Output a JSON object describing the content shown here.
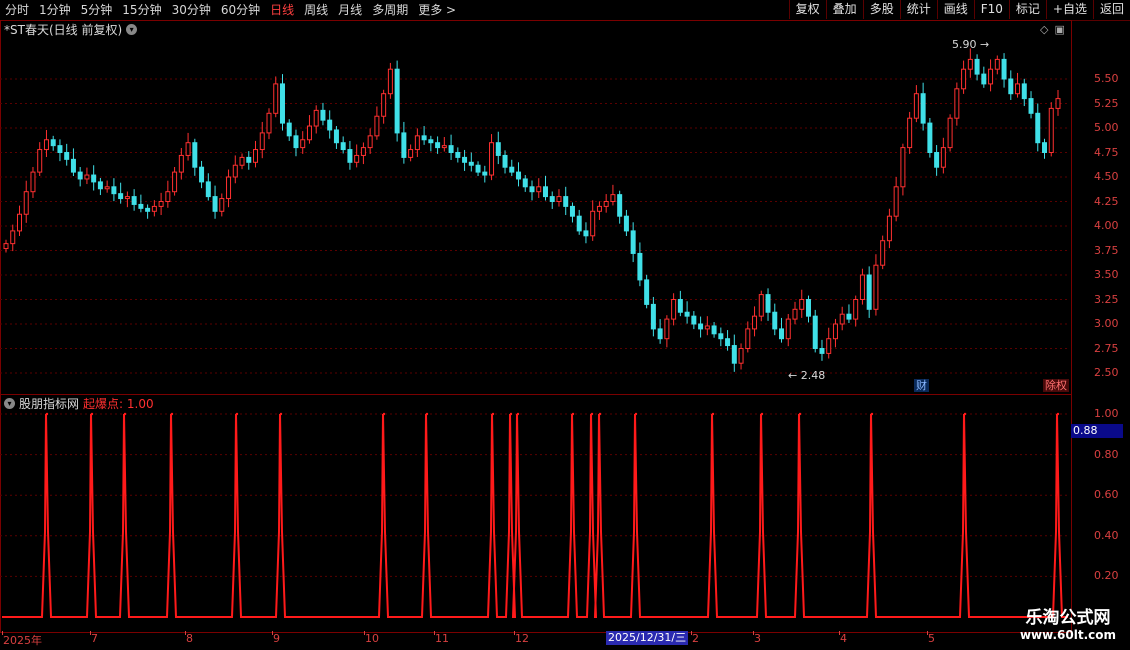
{
  "toolbar": {
    "periods": [
      "分时",
      "1分钟",
      "5分钟",
      "15分钟",
      "30分钟",
      "60分钟",
      "日线",
      "周线",
      "月线",
      "多周期",
      "更多 >"
    ],
    "active_period": "日线",
    "buttons": [
      "复权",
      "叠加",
      "多股",
      "统计",
      "画线",
      "F10",
      "标记",
      "+自选",
      "返回"
    ]
  },
  "main_chart": {
    "title": "*ST春天(日线 前复权)",
    "high_annotation": "5.90",
    "low_annotation": "2.48",
    "tags": {
      "financial": "财",
      "lift": "除权"
    }
  },
  "sub_chart": {
    "name": "股朋指标网",
    "indicator": "起爆点: 1.00",
    "current_value": "0.88"
  },
  "x_axis": {
    "labels": [
      "2025年",
      "7",
      "8",
      "9",
      "10",
      "11",
      "12",
      "2",
      "3",
      "4",
      "5"
    ],
    "cursor_date": "2025/12/31/三"
  },
  "watermark": {
    "line1": "乐淘公式网",
    "line2": "www.60lt.com"
  },
  "chart_data": [
    {
      "type": "candlestick",
      "title": "*ST春天(日线 前复权)",
      "y_ticks": [
        "5.50",
        "5.25",
        "5.00",
        "4.75",
        "4.50",
        "4.25",
        "4.00",
        "3.75",
        "3.50",
        "3.25",
        "3.00",
        "2.75",
        "2.50"
      ],
      "ylim": [
        2.35,
        6.05
      ],
      "colors": {
        "up": "#ff3030",
        "down": "#40e0e8"
      },
      "x_labels": [
        "2025年",
        "7",
        "8",
        "9",
        "10",
        "11",
        "12",
        "2",
        "3",
        "4",
        "5"
      ],
      "close": [
        3.82,
        3.95,
        4.12,
        4.35,
        4.55,
        4.78,
        4.88,
        4.82,
        4.75,
        4.68,
        4.55,
        4.48,
        4.52,
        4.45,
        4.38,
        4.4,
        4.33,
        4.28,
        4.3,
        4.22,
        4.18,
        4.15,
        4.2,
        4.25,
        4.35,
        4.55,
        4.72,
        4.85,
        4.6,
        4.45,
        4.3,
        4.15,
        4.28,
        4.5,
        4.62,
        4.7,
        4.65,
        4.78,
        4.95,
        5.15,
        5.45,
        5.05,
        4.92,
        4.8,
        4.88,
        5.02,
        5.18,
        5.08,
        4.98,
        4.85,
        4.78,
        4.65,
        4.72,
        4.8,
        4.92,
        5.12,
        5.35,
        5.6,
        4.95,
        4.7,
        4.78,
        4.92,
        4.88,
        4.85,
        4.8,
        4.82,
        4.75,
        4.7,
        4.65,
        4.62,
        4.55,
        4.52,
        4.85,
        4.72,
        4.6,
        4.55,
        4.48,
        4.4,
        4.35,
        4.4,
        4.3,
        4.25,
        4.3,
        4.2,
        4.1,
        3.95,
        3.9,
        4.15,
        4.2,
        4.25,
        4.32,
        4.1,
        3.95,
        3.72,
        3.45,
        3.2,
        2.95,
        2.85,
        3.05,
        3.25,
        3.12,
        3.08,
        3.0,
        2.95,
        2.98,
        2.9,
        2.85,
        2.78,
        2.6,
        2.75,
        2.95,
        3.08,
        3.3,
        3.12,
        2.95,
        2.85,
        3.05,
        3.15,
        3.25,
        3.08,
        2.75,
        2.7,
        2.85,
        3.0,
        3.1,
        3.05,
        3.25,
        3.5,
        3.15,
        3.6,
        3.85,
        4.1,
        4.4,
        4.8,
        5.1,
        5.35,
        5.05,
        4.75,
        4.6,
        4.8,
        5.1,
        5.4,
        5.6,
        5.7,
        5.55,
        5.45,
        5.6,
        5.7,
        5.5,
        5.35,
        5.45,
        5.3,
        5.15,
        4.85,
        4.75,
        5.2,
        5.3
      ],
      "high_label": "5.90",
      "low_label": "2.48"
    },
    {
      "type": "line",
      "title": "起爆点",
      "y_ticks": [
        "1.00",
        "0.80",
        "0.60",
        "0.40",
        "0.20"
      ],
      "ylim": [
        0,
        1.05
      ],
      "colors": {
        "line": "#ff1a1a"
      },
      "spike_x": [
        47,
        92,
        125,
        172,
        237,
        281,
        384,
        427,
        493,
        511,
        518,
        573,
        592,
        600,
        636,
        713,
        762,
        800,
        872,
        965,
        1058
      ]
    }
  ]
}
